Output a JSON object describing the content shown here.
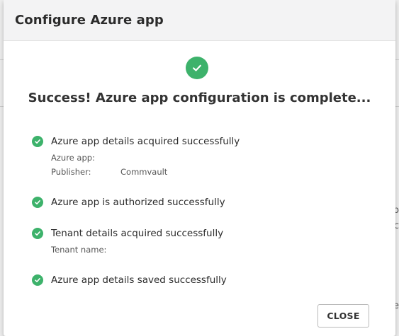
{
  "dialog": {
    "title": "Configure Azure app",
    "headline": "Success! Azure app configuration is complete...",
    "close_label": "CLOSE"
  },
  "steps": [
    {
      "label": "Azure app details acquired successfully",
      "details": [
        {
          "key": "Azure app:",
          "value": ""
        },
        {
          "key": "Publisher:",
          "value": "Commvault"
        }
      ]
    },
    {
      "label": "Azure app is authorized successfully",
      "details": []
    },
    {
      "label": "Tenant details acquired successfully",
      "details": [
        {
          "key": "Tenant name:",
          "value": ""
        }
      ]
    },
    {
      "label": "Azure app details saved successfully",
      "details": []
    }
  ],
  "background": {
    "edge_letters": [
      "p",
      "c",
      "e"
    ]
  },
  "colors": {
    "success": "#3db26b",
    "header_bg": "#f3f3f4"
  }
}
